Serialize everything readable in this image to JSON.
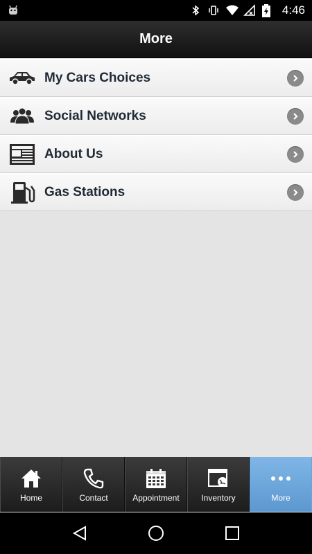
{
  "status_bar": {
    "time": "4:46",
    "icons": [
      "android-icon",
      "bluetooth-icon",
      "vibrate-icon",
      "wifi-icon",
      "no-signal-icon",
      "battery-charging-icon"
    ]
  },
  "header": {
    "title": "More"
  },
  "menu": {
    "items": [
      {
        "label": "My Cars Choices",
        "icon": "car-icon"
      },
      {
        "label": "Social Networks",
        "icon": "people-icon"
      },
      {
        "label": "About Us",
        "icon": "newspaper-icon"
      },
      {
        "label": "Gas Stations",
        "icon": "gas-pump-icon"
      }
    ]
  },
  "tabs": {
    "items": [
      {
        "label": "Home",
        "icon": "home-icon"
      },
      {
        "label": "Contact",
        "icon": "phone-icon"
      },
      {
        "label": "Appointment",
        "icon": "calendar-icon"
      },
      {
        "label": "Inventory",
        "icon": "browser-globe-icon"
      },
      {
        "label": "More",
        "icon": "more-dots-icon",
        "active": true
      }
    ]
  },
  "colors": {
    "active_tab": "#6fa8dc",
    "header": "#1a1a1a",
    "background": "#e4e4e4"
  }
}
